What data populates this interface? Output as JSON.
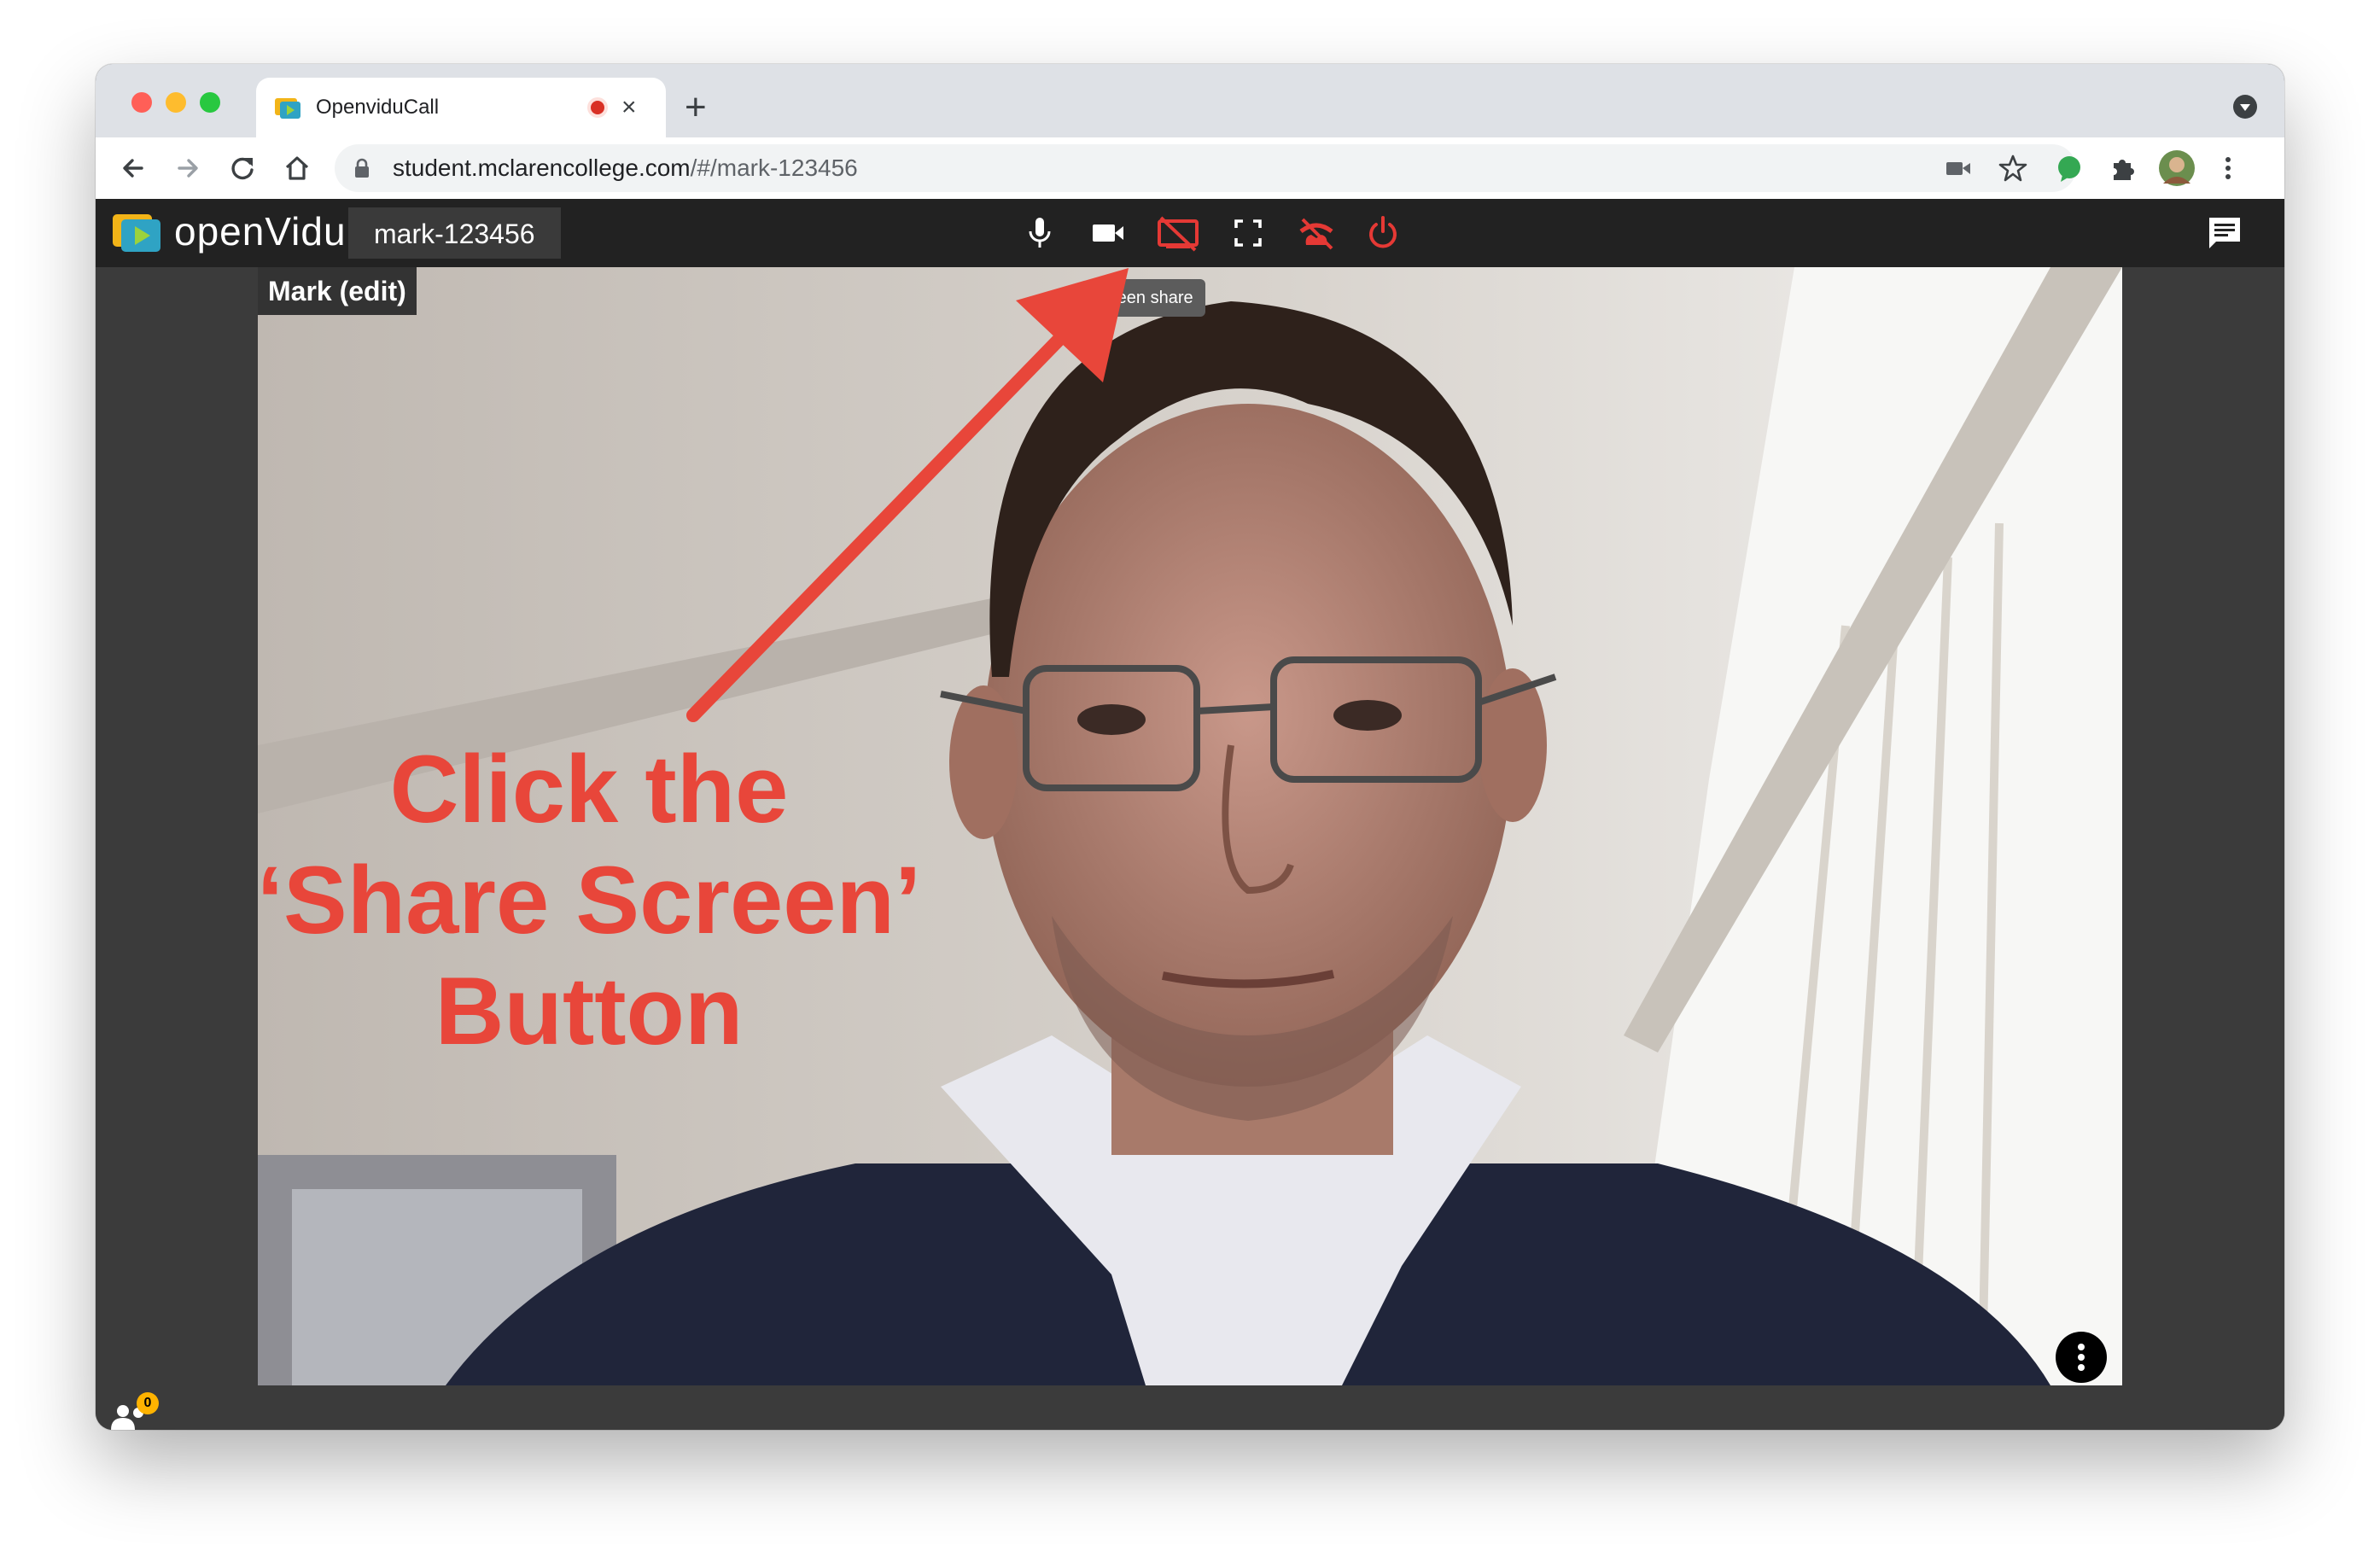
{
  "browser": {
    "tab_title": "OpenviduCall",
    "tab_close": "×",
    "new_tab": "+",
    "url_host": "student.mclarencollege.com",
    "url_path": "/#/mark-123456"
  },
  "app": {
    "logo_text": "openVidu",
    "session_name": "mark-123456",
    "tooltip": "creen share",
    "participant_name": "Mark (edit)",
    "participants_count": "0",
    "colors": {
      "header_bg": "#222222",
      "active_red": "#e53935",
      "accent_yellow": "#ffb300"
    },
    "controls": [
      {
        "name": "mic-icon",
        "state": "on"
      },
      {
        "name": "camera-icon",
        "state": "on"
      },
      {
        "name": "screen-share-icon",
        "state": "off"
      },
      {
        "name": "fullscreen-icon",
        "state": "on"
      },
      {
        "name": "leave-session-icon",
        "state": "red"
      },
      {
        "name": "power-icon",
        "state": "red"
      }
    ]
  },
  "annotation": {
    "line1": "Click the",
    "line2": "‘Share Screen’",
    "line3": "Button",
    "color": "#e8463a"
  }
}
